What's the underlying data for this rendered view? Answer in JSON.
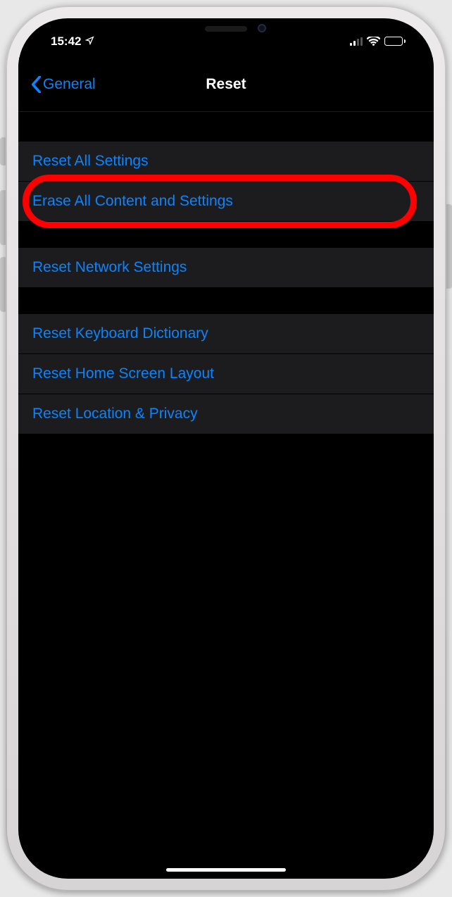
{
  "status": {
    "time": "15:42",
    "location_icon": "location-arrow",
    "signal_bars_active": 2,
    "signal_bars_total": 4,
    "wifi_icon": "wifi",
    "battery_icon": "battery"
  },
  "nav": {
    "back_label": "General",
    "title": "Reset"
  },
  "groups": [
    {
      "rows": [
        {
          "label": "Reset All Settings"
        },
        {
          "label": "Erase All Content and Settings"
        }
      ]
    },
    {
      "rows": [
        {
          "label": "Reset Network Settings"
        }
      ]
    },
    {
      "rows": [
        {
          "label": "Reset Keyboard Dictionary"
        },
        {
          "label": "Reset Home Screen Layout"
        },
        {
          "label": "Reset Location & Privacy"
        }
      ]
    }
  ],
  "highlight": {
    "target_row_label": "Erase All Content and Settings",
    "color": "#ff0000"
  }
}
